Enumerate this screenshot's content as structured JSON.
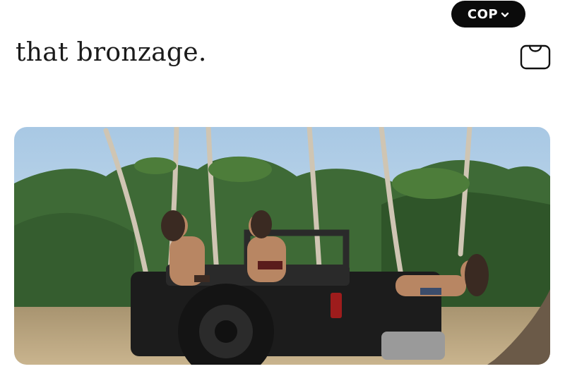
{
  "header": {
    "currency": {
      "label": "COP",
      "icon": "chevron-down-icon"
    },
    "brand_title": "that bronzage.",
    "cart_icon": "shopping-bag-icon"
  },
  "hero": {
    "scene": "hero-image"
  },
  "colors": {
    "pill_bg": "#0b0b0b",
    "pill_text": "#ffffff",
    "title": "#1a1a1a",
    "sky": "#b9d3e8",
    "foliage": "#3f6b3a",
    "ground": "#b8a27e",
    "vehicle": "#1e1e1e"
  }
}
